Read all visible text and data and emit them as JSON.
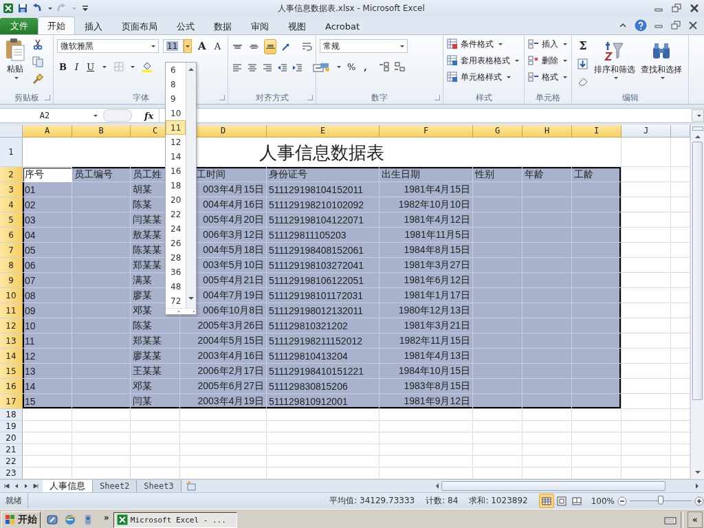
{
  "window": {
    "title": "人事信息数据表.xlsx - Microsoft Excel"
  },
  "ribbon_tabs": [
    {
      "label": "文件",
      "kind": "file",
      "selected": false
    },
    {
      "label": "开始",
      "kind": "tab",
      "selected": true
    },
    {
      "label": "插入",
      "kind": "tab",
      "selected": false
    },
    {
      "label": "页面布局",
      "kind": "tab",
      "selected": false
    },
    {
      "label": "公式",
      "kind": "tab",
      "selected": false
    },
    {
      "label": "数据",
      "kind": "tab",
      "selected": false
    },
    {
      "label": "审阅",
      "kind": "tab",
      "selected": false
    },
    {
      "label": "视图",
      "kind": "tab",
      "selected": false
    },
    {
      "label": "Acrobat",
      "kind": "tab",
      "selected": false
    }
  ],
  "ribbon": {
    "clipboard": {
      "paste": "粘贴",
      "label": "剪贴板"
    },
    "font": {
      "name": "微软雅黑",
      "size": "11",
      "grow": "A",
      "shrink": "A",
      "bold": "B",
      "italic": "I",
      "underline": "U",
      "label": "字体"
    },
    "alignment": {
      "vertical": [
        {
          "kind": "top",
          "selected": false
        },
        {
          "kind": "middle",
          "selected": false
        },
        {
          "kind": "bottom",
          "selected": true
        }
      ],
      "label": "对齐方式"
    },
    "number": {
      "format": "常规",
      "percent": "%",
      "comma": ",",
      "label": "数字"
    },
    "styles": {
      "items": [
        "条件格式",
        "套用表格格式",
        "单元格样式"
      ],
      "label": "样式"
    },
    "cells": {
      "items": [
        "插入",
        "删除",
        "格式"
      ],
      "label": "单元格"
    },
    "editing": {
      "sum": "Σ",
      "sort": "排序和筛选",
      "find": "查找和选择",
      "label": "编辑"
    }
  },
  "font_size_list": [
    {
      "label": "6",
      "selected": false
    },
    {
      "label": "8",
      "selected": false
    },
    {
      "label": "9",
      "selected": false
    },
    {
      "label": "10",
      "selected": false
    },
    {
      "label": "11",
      "selected": true
    },
    {
      "label": "12",
      "selected": false
    },
    {
      "label": "14",
      "selected": false
    },
    {
      "label": "16",
      "selected": false
    },
    {
      "label": "18",
      "selected": false
    },
    {
      "label": "20",
      "selected": false
    },
    {
      "label": "22",
      "selected": false
    },
    {
      "label": "24",
      "selected": false
    },
    {
      "label": "26",
      "selected": false
    },
    {
      "label": "28",
      "selected": false
    },
    {
      "label": "36",
      "selected": false
    },
    {
      "label": "48",
      "selected": false
    },
    {
      "label": "72",
      "selected": false
    }
  ],
  "formula_bar": {
    "name_box": "A2",
    "function_label": "fx"
  },
  "sheet": {
    "columns": [
      {
        "label": "A",
        "selected": true,
        "active": true
      },
      {
        "label": "B",
        "selected": true,
        "active": false
      },
      {
        "label": "C",
        "selected": true,
        "active": false
      },
      {
        "label": "D",
        "selected": true,
        "active": false
      },
      {
        "label": "E",
        "selected": true,
        "active": false
      },
      {
        "label": "F",
        "selected": true,
        "active": false
      },
      {
        "label": "G",
        "selected": true,
        "active": false
      },
      {
        "label": "H",
        "selected": true,
        "active": false
      },
      {
        "label": "I",
        "selected": true,
        "active": false
      },
      {
        "label": "J",
        "selected": false,
        "active": false
      }
    ],
    "rows": [
      {
        "number": "1",
        "kind": "title",
        "selected": false,
        "title": "人事信息数据表"
      },
      {
        "number": "2",
        "kind": "header",
        "selected": true,
        "active": true,
        "cells": {
          "A": "序号",
          "B": "员工编号",
          "C": "员工姓",
          "D": "工时间",
          "E": "身份证号",
          "F": "出生日期",
          "G": "性别",
          "H": "年龄",
          "I": "工龄"
        }
      },
      {
        "number": "3",
        "kind": "record",
        "selected": true,
        "cells": {
          "A": "01",
          "C": "胡某",
          "D": "003年4月15日",
          "E": "511129198104152011",
          "F": "1981年4月15日"
        }
      },
      {
        "number": "4",
        "kind": "record",
        "selected": true,
        "cells": {
          "A": "02",
          "C": "陈某",
          "D": "004年4月16日",
          "E": "511129198210102092",
          "F": "1982年10月10日"
        }
      },
      {
        "number": "5",
        "kind": "record",
        "selected": true,
        "cells": {
          "A": "03",
          "C": "闫某某",
          "D": "005年4月20日",
          "E": "511129198104122071",
          "F": "1981年4月12日"
        }
      },
      {
        "number": "6",
        "kind": "record",
        "selected": true,
        "cells": {
          "A": "04",
          "C": "敖某某",
          "D": "006年3月12日",
          "E": "511129811105203",
          "F": "1981年11月5日"
        }
      },
      {
        "number": "7",
        "kind": "record",
        "selected": true,
        "cells": {
          "A": "05",
          "C": "陈某某",
          "D": "004年5月18日",
          "E": "511129198408152061",
          "F": "1984年8月15日"
        }
      },
      {
        "number": "8",
        "kind": "record",
        "selected": true,
        "cells": {
          "A": "06",
          "C": "郑某某",
          "D": "003年5月10日",
          "E": "511129198103272041",
          "F": "1981年3月27日"
        }
      },
      {
        "number": "9",
        "kind": "record",
        "selected": true,
        "cells": {
          "A": "07",
          "C": "满某",
          "D": "005年4月21日",
          "E": "511129198106122051",
          "F": "1981年6月12日"
        }
      },
      {
        "number": "10",
        "kind": "record",
        "selected": true,
        "cells": {
          "A": "08",
          "C": "廖某",
          "D": "004年7月19日",
          "E": "511129198101172031",
          "F": "1981年1月17日"
        }
      },
      {
        "number": "11",
        "kind": "record",
        "selected": true,
        "cells": {
          "A": "09",
          "C": "邓某",
          "D": "006年10月8日",
          "E": "511129198012132011",
          "F": "1980年12月13日"
        }
      },
      {
        "number": "12",
        "kind": "record",
        "selected": true,
        "cells": {
          "A": "10",
          "C": "陈某",
          "D": "2005年3月26日",
          "E": "511129810321202",
          "F": "1981年3月21日"
        }
      },
      {
        "number": "13",
        "kind": "record",
        "selected": true,
        "cells": {
          "A": "11",
          "C": "郑某某",
          "D": "2004年5月15日",
          "E": "511129198211152012",
          "F": "1982年11月15日"
        }
      },
      {
        "number": "14",
        "kind": "record",
        "selected": true,
        "cells": {
          "A": "12",
          "C": "廖某某",
          "D": "2003年4月16日",
          "E": "511129810413204",
          "F": "1981年4月13日"
        }
      },
      {
        "number": "15",
        "kind": "record",
        "selected": true,
        "cells": {
          "A": "13",
          "C": "王某某",
          "D": "2006年2月17日",
          "E": "511129198410151221",
          "F": "1984年10月15日"
        }
      },
      {
        "number": "16",
        "kind": "record",
        "selected": true,
        "cells": {
          "A": "14",
          "C": "邓某",
          "D": "2005年6月27日",
          "E": "511129830815206",
          "F": "1983年8月15日"
        }
      },
      {
        "number": "17",
        "kind": "record",
        "selected": true,
        "cells": {
          "A": "15",
          "C": "闫某",
          "D": "2003年4月19日",
          "E": "511129810912001",
          "F": "1981年9月12日"
        }
      },
      {
        "number": "18",
        "kind": "blank",
        "selected": false
      },
      {
        "number": "19",
        "kind": "blank",
        "selected": false
      },
      {
        "number": "20",
        "kind": "blank",
        "selected": false
      },
      {
        "number": "21",
        "kind": "blank",
        "selected": false
      },
      {
        "number": "22",
        "kind": "blank",
        "selected": false
      },
      {
        "number": "23",
        "kind": "blank",
        "selected": false
      }
    ]
  },
  "sheet_tabs": [
    {
      "label": "人事信息",
      "selected": true
    },
    {
      "label": "Sheet2",
      "selected": false
    },
    {
      "label": "Sheet3",
      "selected": false
    }
  ],
  "status_bar": {
    "ready": "就绪",
    "average": "平均值: 34129.73333",
    "count": "计数: 84",
    "sum": "求和: 1023892",
    "views": [
      {
        "kind": "normal",
        "selected": true
      },
      {
        "kind": "page_layout",
        "selected": false
      },
      {
        "kind": "page_break",
        "selected": false
      }
    ],
    "zoom": "100%",
    "zoom_slider": {
      "level": 0.5
    }
  },
  "taskbar": {
    "start": "开始",
    "chevron": "»",
    "tasks": [
      {
        "label": "Microsoft Excel - ...",
        "selected": true
      }
    ],
    "tray_chevron": "«"
  }
}
